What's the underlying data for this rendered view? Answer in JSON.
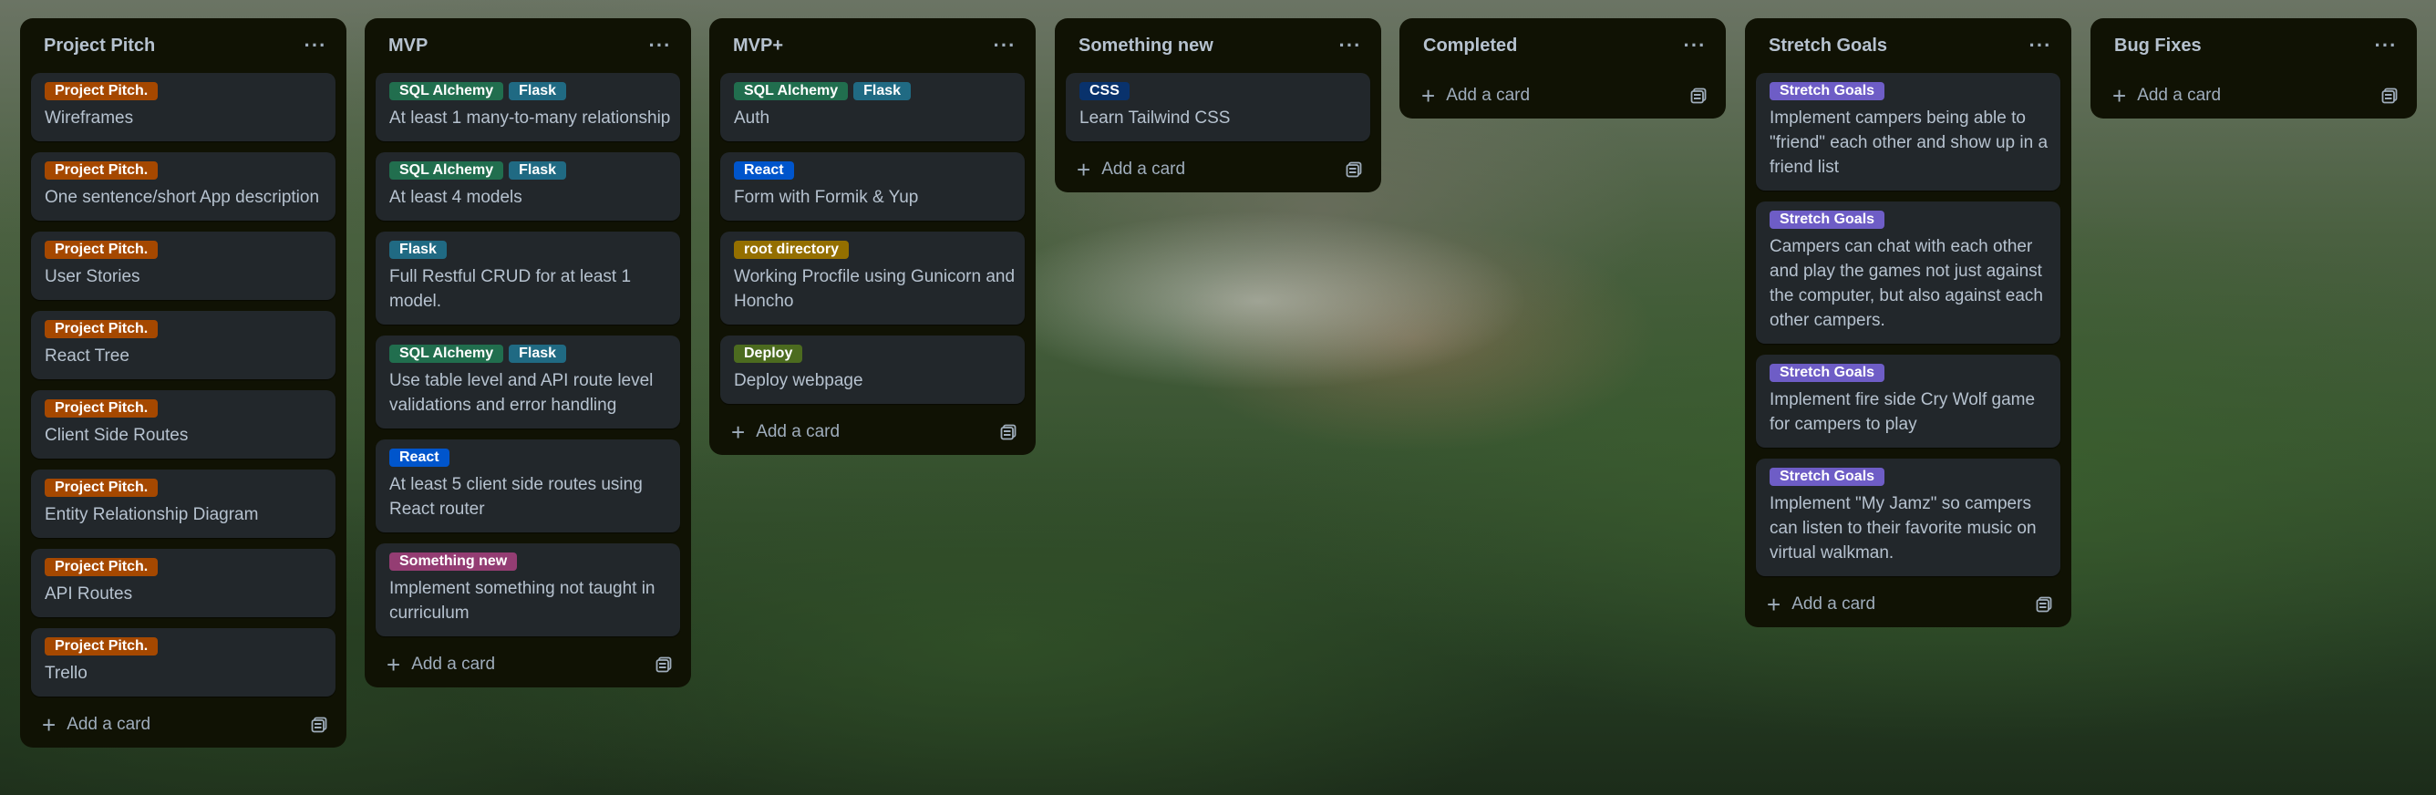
{
  "label_colors": {
    "Project Pitch.": "#a54800",
    "SQL Alchemy": "#216e4e",
    "Flask": "#206a83",
    "React": "#0055cc",
    "CSS": "#09326c",
    "root directory": "#946f00",
    "Deploy": "#4c6b1f",
    "Something new": "#943d73",
    "Stretch Goals": "#6e5dc6"
  },
  "add_card_label": "Add a card",
  "lists": [
    {
      "title": "Project Pitch",
      "cards": [
        {
          "labels": [
            "Project Pitch."
          ],
          "text": "Wireframes"
        },
        {
          "labels": [
            "Project Pitch."
          ],
          "text": "One sentence/short App description"
        },
        {
          "labels": [
            "Project Pitch."
          ],
          "text": "User Stories"
        },
        {
          "labels": [
            "Project Pitch."
          ],
          "text": "React Tree"
        },
        {
          "labels": [
            "Project Pitch."
          ],
          "text": "Client Side Routes"
        },
        {
          "labels": [
            "Project Pitch."
          ],
          "text": "Entity Relationship Diagram"
        },
        {
          "labels": [
            "Project Pitch."
          ],
          "text": "API Routes"
        },
        {
          "labels": [
            "Project Pitch."
          ],
          "text": "Trello"
        }
      ]
    },
    {
      "title": "MVP",
      "cards": [
        {
          "labels": [
            "SQL Alchemy",
            "Flask"
          ],
          "text": "At least 1 many-to-many relationship"
        },
        {
          "labels": [
            "SQL Alchemy",
            "Flask"
          ],
          "text": "At least 4 models"
        },
        {
          "labels": [
            "Flask"
          ],
          "text": "Full Restful CRUD for at least 1 model."
        },
        {
          "labels": [
            "SQL Alchemy",
            "Flask"
          ],
          "text": "Use table level and API route level validations and error handling"
        },
        {
          "labels": [
            "React"
          ],
          "text": "At least 5 client side routes using React router"
        },
        {
          "labels": [
            "Something new"
          ],
          "text": "Implement something not taught in curriculum"
        }
      ]
    },
    {
      "title": "MVP+",
      "cards": [
        {
          "labels": [
            "SQL Alchemy",
            "Flask"
          ],
          "text": "Auth"
        },
        {
          "labels": [
            "React"
          ],
          "text": "Form with Formik & Yup"
        },
        {
          "labels": [
            "root directory"
          ],
          "text": "Working Procfile using Gunicorn and Honcho"
        },
        {
          "labels": [
            "Deploy"
          ],
          "text": "Deploy webpage"
        }
      ]
    },
    {
      "title": "Something new",
      "cards": [
        {
          "labels": [
            "CSS"
          ],
          "text": "Learn Tailwind CSS"
        }
      ]
    },
    {
      "title": "Completed",
      "cards": []
    },
    {
      "title": "Stretch Goals",
      "cards": [
        {
          "labels": [
            "Stretch Goals"
          ],
          "text": "Implement campers being able to \"friend\" each other and show up in a friend list"
        },
        {
          "labels": [
            "Stretch Goals"
          ],
          "text": "Campers can chat with each other and play the games not just against the computer, but also against each other campers."
        },
        {
          "labels": [
            "Stretch Goals"
          ],
          "text": "Implement fire side Cry Wolf game for campers to play"
        },
        {
          "labels": [
            "Stretch Goals"
          ],
          "text": "Implement \"My Jamz\" so campers can listen to their favorite music on virtual walkman."
        }
      ]
    },
    {
      "title": "Bug Fixes",
      "cards": []
    }
  ]
}
